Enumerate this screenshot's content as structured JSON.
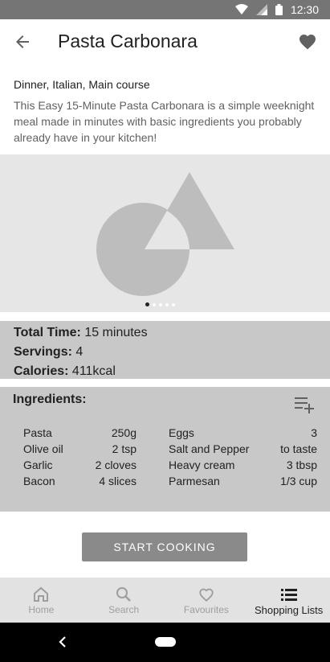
{
  "status_bar": {
    "time": "12:30"
  },
  "app_bar": {
    "title": "Pasta Carbonara"
  },
  "recipe": {
    "tags": "Dinner, Italian, Main course",
    "description": "This Easy 15-Minute Pasta Carbonara is a simple weeknight meal made in minutes with basic ingredients you probably already have in your kitchen!"
  },
  "carousel": {
    "slide_count": 5,
    "active_slide": 1
  },
  "info": {
    "total_time_label": "Total Time:",
    "total_time_value": "15 minutes",
    "servings_label": "Servings:",
    "servings_value": "4",
    "calories_label": "Calories:",
    "calories_value": "411kcal"
  },
  "ingredients": {
    "title": "Ingredients:",
    "left": [
      {
        "name": "Pasta",
        "amount": "250g"
      },
      {
        "name": "Olive oil",
        "amount": "2 tsp"
      },
      {
        "name": "Garlic",
        "amount": "2 cloves"
      },
      {
        "name": "Bacon",
        "amount": "4 slices"
      }
    ],
    "right": [
      {
        "name": "Eggs",
        "amount": "3"
      },
      {
        "name": "Salt and Pepper",
        "amount": "to taste"
      },
      {
        "name": "Heavy cream",
        "amount": "3 tbsp"
      },
      {
        "name": "Parmesan",
        "amount": "1/3 cup"
      }
    ]
  },
  "actions": {
    "start_cooking": "START COOKING"
  },
  "bottom_nav": {
    "items": [
      {
        "label": "Home",
        "icon": "home-icon"
      },
      {
        "label": "Search",
        "icon": "search-icon"
      },
      {
        "label": "Favourites",
        "icon": "heart-outline-icon"
      },
      {
        "label": "Shopping Lists",
        "icon": "list-icon",
        "active": true
      }
    ]
  }
}
